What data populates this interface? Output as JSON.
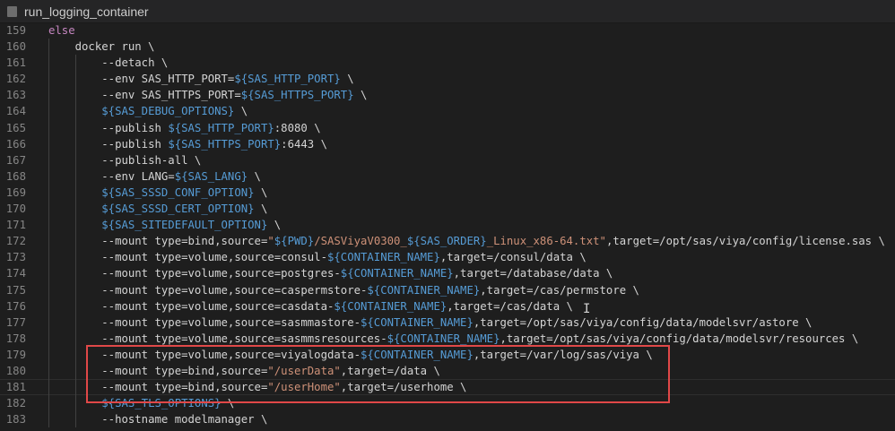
{
  "tab": {
    "title": "run_logging_container"
  },
  "lines": [
    {
      "n": "159",
      "indent": 0,
      "segs": [
        [
          "else",
          "kw"
        ]
      ]
    },
    {
      "n": "160",
      "indent": 1,
      "segs": [
        [
          "docker run \\",
          ""
        ]
      ]
    },
    {
      "n": "161",
      "indent": 2,
      "segs": [
        [
          "--detach \\",
          ""
        ]
      ]
    },
    {
      "n": "162",
      "indent": 2,
      "segs": [
        [
          "--env SAS_HTTP_PORT=",
          ""
        ],
        [
          "${SAS_HTTP_PORT}",
          "var"
        ],
        [
          " \\",
          ""
        ]
      ]
    },
    {
      "n": "163",
      "indent": 2,
      "segs": [
        [
          "--env SAS_HTTPS_PORT=",
          ""
        ],
        [
          "${SAS_HTTPS_PORT}",
          "var"
        ],
        [
          " \\",
          ""
        ]
      ]
    },
    {
      "n": "164",
      "indent": 2,
      "segs": [
        [
          "${SAS_DEBUG_OPTIONS}",
          "var"
        ],
        [
          " \\",
          ""
        ]
      ]
    },
    {
      "n": "165",
      "indent": 2,
      "segs": [
        [
          "--publish ",
          ""
        ],
        [
          "${SAS_HTTP_PORT}",
          "var"
        ],
        [
          ":8080 \\",
          ""
        ]
      ]
    },
    {
      "n": "166",
      "indent": 2,
      "segs": [
        [
          "--publish ",
          ""
        ],
        [
          "${SAS_HTTPS_PORT}",
          "var"
        ],
        [
          ":6443 \\",
          ""
        ]
      ]
    },
    {
      "n": "167",
      "indent": 2,
      "segs": [
        [
          "--publish-all \\",
          ""
        ]
      ]
    },
    {
      "n": "168",
      "indent": 2,
      "segs": [
        [
          "--env LANG=",
          ""
        ],
        [
          "${SAS_LANG}",
          "var"
        ],
        [
          " \\",
          ""
        ]
      ]
    },
    {
      "n": "169",
      "indent": 2,
      "segs": [
        [
          "${SAS_SSSD_CONF_OPTION}",
          "var"
        ],
        [
          " \\",
          ""
        ]
      ]
    },
    {
      "n": "170",
      "indent": 2,
      "segs": [
        [
          "${SAS_SSSD_CERT_OPTION}",
          "var"
        ],
        [
          " \\",
          ""
        ]
      ]
    },
    {
      "n": "171",
      "indent": 2,
      "segs": [
        [
          "${SAS_SITEDEFAULT_OPTION}",
          "var"
        ],
        [
          " \\",
          ""
        ]
      ]
    },
    {
      "n": "172",
      "indent": 2,
      "segs": [
        [
          "--mount type=bind,source=",
          ""
        ],
        [
          "\"",
          "str"
        ],
        [
          "${PWD}",
          "var"
        ],
        [
          "/SASViyaV0300_",
          "str"
        ],
        [
          "${SAS_ORDER}",
          "var"
        ],
        [
          "_Linux_x86-64.txt\"",
          "str"
        ],
        [
          ",target=/opt/sas/viya/config/license.sas \\",
          ""
        ]
      ]
    },
    {
      "n": "173",
      "indent": 2,
      "segs": [
        [
          "--mount type=volume,source=consul-",
          ""
        ],
        [
          "${CONTAINER_NAME}",
          "var"
        ],
        [
          ",target=/consul/data \\",
          ""
        ]
      ]
    },
    {
      "n": "174",
      "indent": 2,
      "segs": [
        [
          "--mount type=volume,source=postgres-",
          ""
        ],
        [
          "${CONTAINER_NAME}",
          "var"
        ],
        [
          ",target=/database/data \\",
          ""
        ]
      ]
    },
    {
      "n": "175",
      "indent": 2,
      "segs": [
        [
          "--mount type=volume,source=caspermstore-",
          ""
        ],
        [
          "${CONTAINER_NAME}",
          "var"
        ],
        [
          ",target=/cas/permstore \\",
          ""
        ]
      ]
    },
    {
      "n": "176",
      "indent": 2,
      "segs": [
        [
          "--mount type=volume,source=casdata-",
          ""
        ],
        [
          "${CONTAINER_NAME}",
          "var"
        ],
        [
          ",target=/cas/data \\",
          ""
        ]
      ]
    },
    {
      "n": "177",
      "indent": 2,
      "segs": [
        [
          "--mount type=volume,source=sasmmastore-",
          ""
        ],
        [
          "${CONTAINER_NAME}",
          "var"
        ],
        [
          ",target=/opt/sas/viya/config/data/modelsvr/astore \\",
          ""
        ]
      ]
    },
    {
      "n": "178",
      "indent": 2,
      "segs": [
        [
          "--mount type=volume,source=sasmmsresources-",
          ""
        ],
        [
          "${CONTAINER_NAME}",
          "var"
        ],
        [
          ",target=/opt/sas/viya/config/data/modelsvr/resources \\",
          ""
        ]
      ]
    },
    {
      "n": "179",
      "indent": 2,
      "segs": [
        [
          "--mount type=volume,source=viyalogdata-",
          ""
        ],
        [
          "${CONTAINER_NAME}",
          "var"
        ],
        [
          ",target=/var/log/sas/viya \\",
          ""
        ]
      ]
    },
    {
      "n": "180",
      "indent": 2,
      "segs": [
        [
          "--mount type=bind,source=",
          ""
        ],
        [
          "\"/userData\"",
          "str"
        ],
        [
          ",target=/data \\",
          ""
        ]
      ]
    },
    {
      "n": "181",
      "indent": 2,
      "segs": [
        [
          "--mount type=bind,source=",
          ""
        ],
        [
          "\"/userHome\"",
          "str"
        ],
        [
          ",target=/userhome \\",
          ""
        ]
      ]
    },
    {
      "n": "182",
      "indent": 2,
      "segs": [
        [
          "${SAS_TLS_OPTIONS}",
          "var"
        ],
        [
          " \\",
          ""
        ]
      ]
    },
    {
      "n": "183",
      "indent": 2,
      "segs": [
        [
          "--hostname modelmanager \\",
          ""
        ]
      ]
    }
  ],
  "current_line": "181",
  "highlight_range": [
    "179",
    "181"
  ]
}
